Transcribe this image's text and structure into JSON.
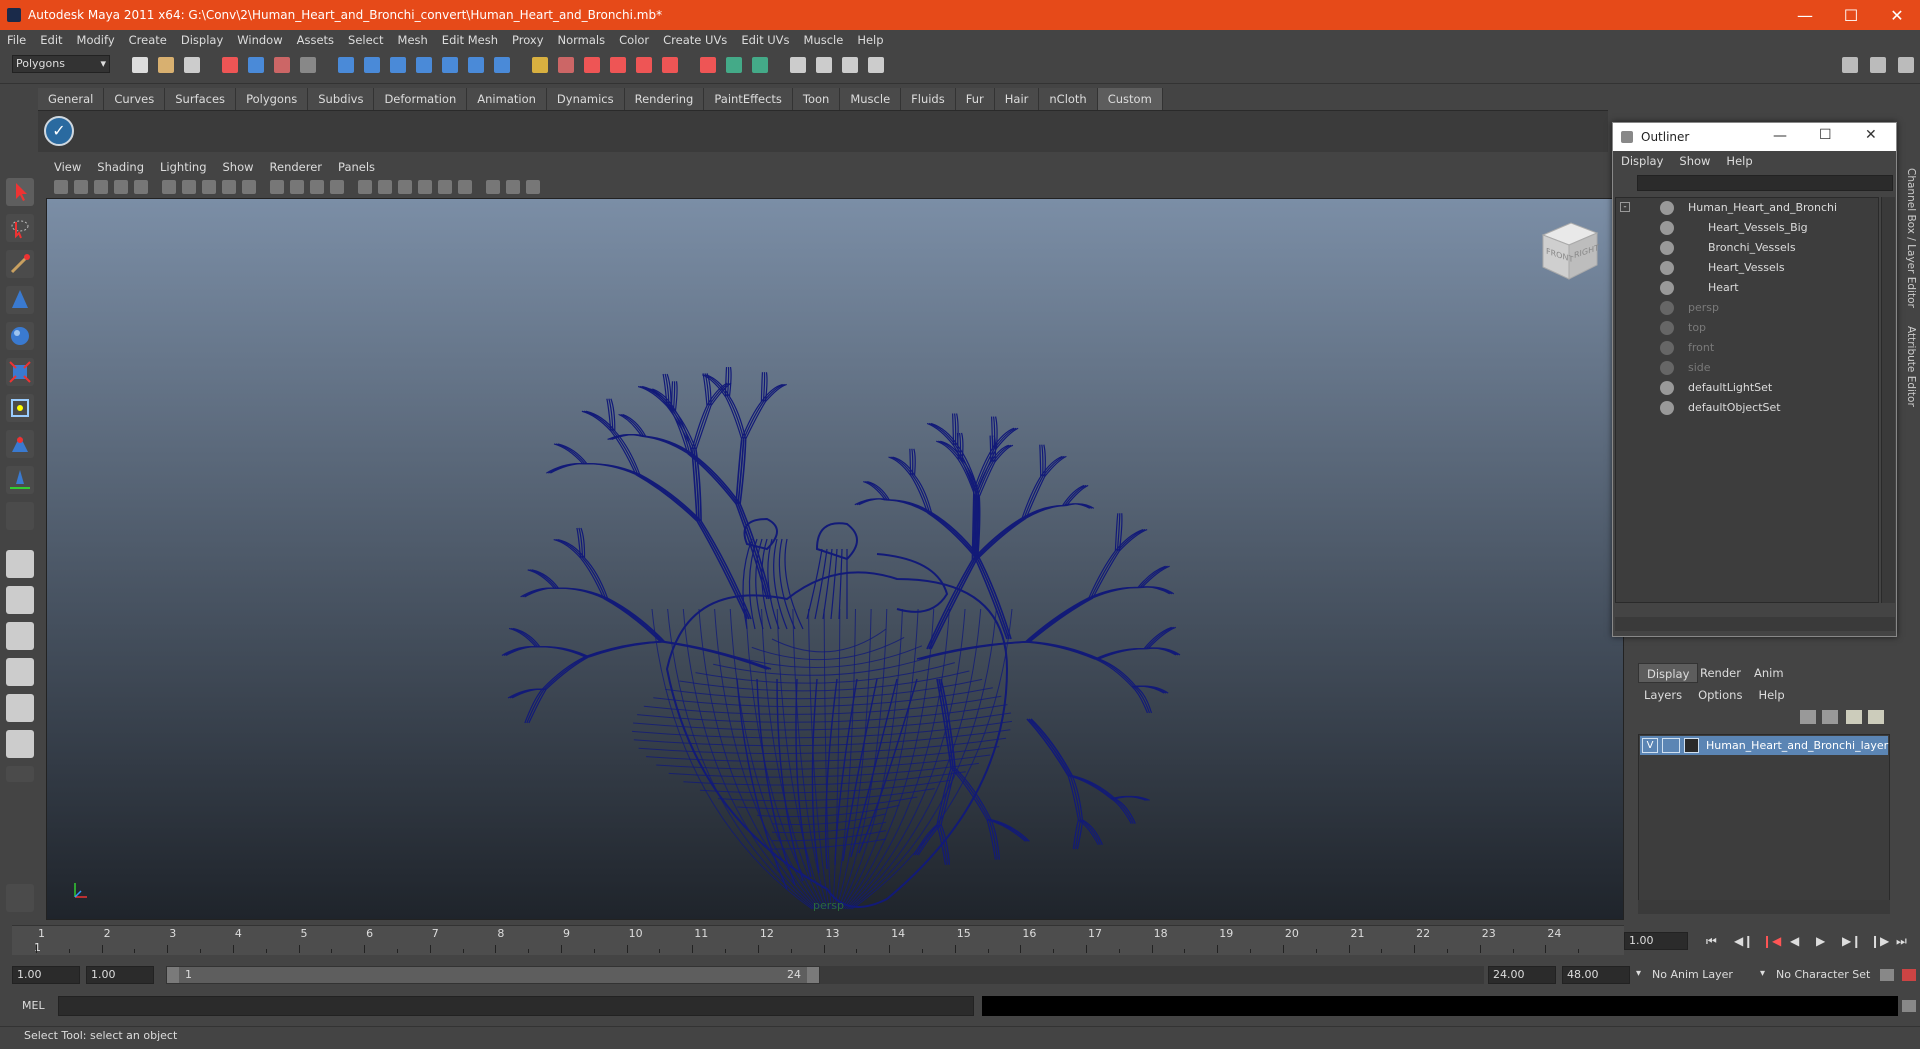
{
  "window": {
    "title": "Autodesk Maya 2011 x64: G:\\Conv\\2\\Human_Heart_and_Bronchi_convert\\Human_Heart_and_Bronchi.mb*"
  },
  "menubar": [
    "File",
    "Edit",
    "Modify",
    "Create",
    "Display",
    "Window",
    "Assets",
    "Select",
    "Mesh",
    "Edit Mesh",
    "Proxy",
    "Normals",
    "Color",
    "Create UVs",
    "Edit UVs",
    "Muscle",
    "Help"
  ],
  "mode_selector": "Polygons",
  "shelf_tabs": [
    "General",
    "Curves",
    "Surfaces",
    "Polygons",
    "Subdivs",
    "Deformation",
    "Animation",
    "Dynamics",
    "Rendering",
    "PaintEffects",
    "Toon",
    "Muscle",
    "Fluids",
    "Fur",
    "Hair",
    "nCloth",
    "Custom"
  ],
  "active_shelf_tab": "Custom",
  "panel_menu": [
    "View",
    "Shading",
    "Lighting",
    "Show",
    "Renderer",
    "Panels"
  ],
  "viewport": {
    "camera": "persp",
    "viewcube_faces": [
      "FRONT",
      "RIGHT"
    ],
    "wire_color": "#121a78"
  },
  "outliner": {
    "title": "Outliner",
    "menu": [
      "Display",
      "Show",
      "Help"
    ],
    "items": [
      {
        "label": "Human_Heart_and_Bronchi",
        "dim": false
      },
      {
        "label": "Heart_Vessels_Big",
        "dim": false
      },
      {
        "label": "Bronchi_Vessels",
        "dim": false
      },
      {
        "label": "Heart_Vessels",
        "dim": false
      },
      {
        "label": "Heart",
        "dim": false
      },
      {
        "label": "persp",
        "dim": true
      },
      {
        "label": "top",
        "dim": true
      },
      {
        "label": "front",
        "dim": true
      },
      {
        "label": "side",
        "dim": true
      },
      {
        "label": "defaultLightSet",
        "dim": false
      },
      {
        "label": "defaultObjectSet",
        "dim": false
      }
    ]
  },
  "side_tabs": [
    "Channel Box / Layer Editor",
    "Attribute Editor"
  ],
  "layer_editor": {
    "tabs": [
      "Display",
      "Render",
      "Anim"
    ],
    "menu": [
      "Layers",
      "Options",
      "Help"
    ],
    "layer": {
      "visible": "V",
      "name": "Human_Heart_and_Bronchi_layer"
    }
  },
  "timeline": {
    "ticks": [
      "1",
      "2",
      "3",
      "4",
      "5",
      "6",
      "7",
      "8",
      "9",
      "10",
      "11",
      "12",
      "13",
      "14",
      "15",
      "16",
      "17",
      "18",
      "19",
      "20",
      "21",
      "22",
      "23",
      "24"
    ],
    "current_frame": "1",
    "current_time_field": "1.00"
  },
  "range": {
    "start": "1.00",
    "anim_start": "1.00",
    "range_start": "1",
    "range_end": "24",
    "playback_end": "24.00",
    "anim_end": "48.00",
    "anim_layer": "No Anim Layer",
    "character_set": "No Character Set"
  },
  "command_line": {
    "label": "MEL"
  },
  "status": {
    "text": "Select Tool: select an object"
  }
}
